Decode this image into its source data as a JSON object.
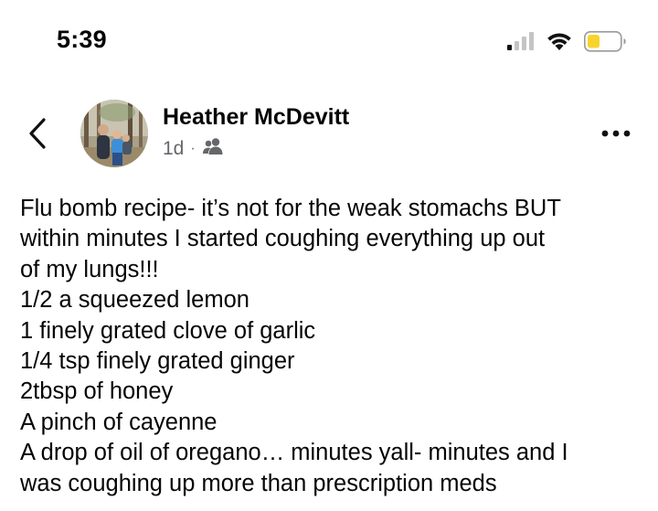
{
  "status_bar": {
    "time": "5:39",
    "icons": [
      "cellular-signal-icon",
      "wifi-icon",
      "battery-low-icon"
    ],
    "battery_color": "#f7d42b"
  },
  "header": {
    "back_icon": "chevron-left-icon",
    "author_name": "Heather McDevitt",
    "timestamp": "1d",
    "separator": "·",
    "audience_icon": "friends-audience-icon",
    "more_icon": "more-horizontal-icon"
  },
  "post": {
    "lines": [
      "Flu bomb recipe- it’s not for the weak stomachs BUT",
      "within minutes I started coughing everything up out",
      "of my lungs!!!",
      "1/2 a squeezed lemon",
      "1 finely grated clove of garlic",
      "1/4 tsp finely grated ginger",
      "2tbsp of honey",
      "A pinch of cayenne",
      "A drop of oil of oregano… minutes yall- minutes and I",
      "was coughing up more than prescription meds"
    ]
  },
  "colors": {
    "text": "#050505",
    "secondary_text": "#65676b"
  }
}
